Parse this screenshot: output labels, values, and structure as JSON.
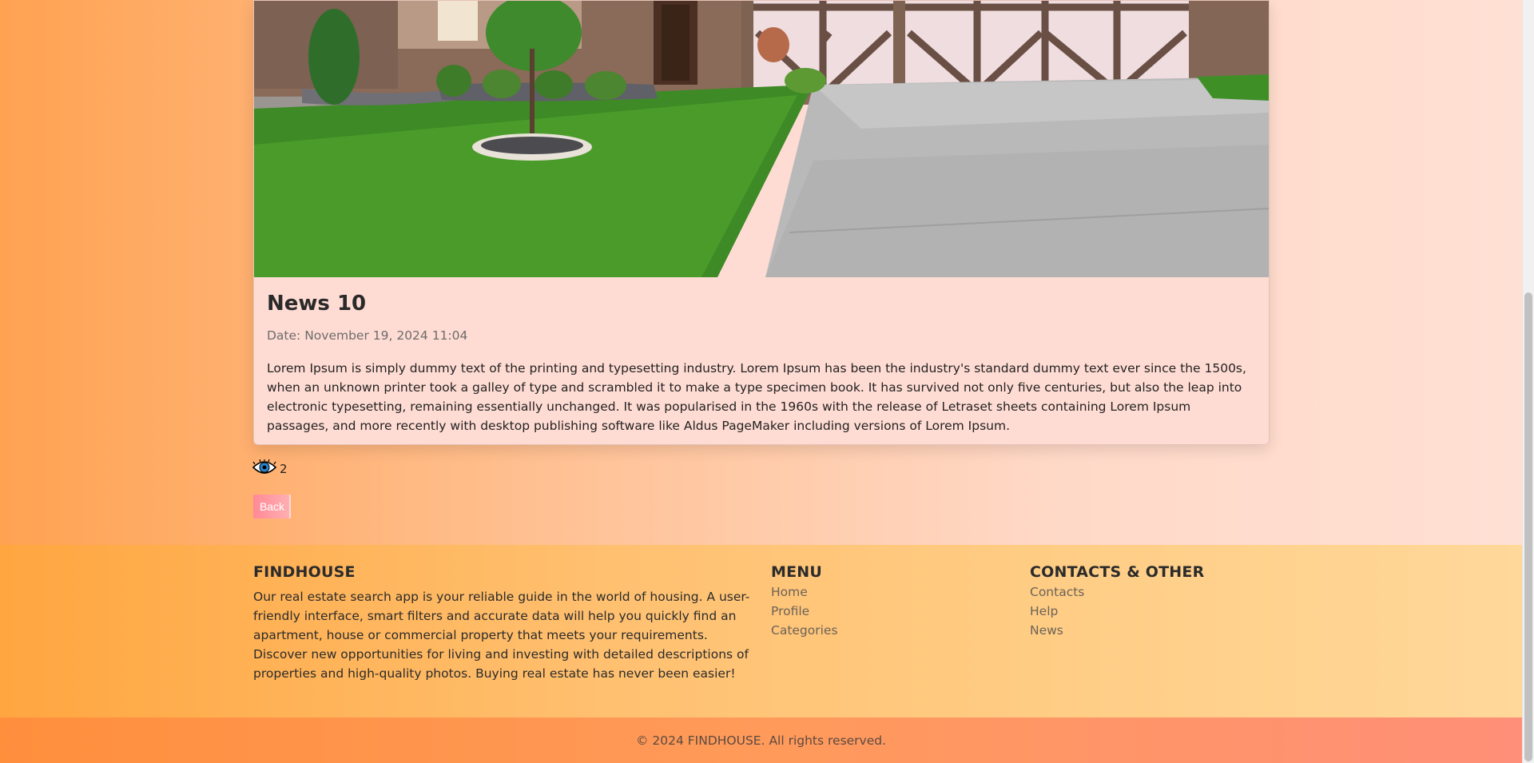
{
  "article": {
    "title": "News 10",
    "date": "Date: November 19, 2024 11:04",
    "body": "Lorem Ipsum is simply dummy text of the printing and typesetting industry. Lorem Ipsum has been the industry's standard dummy text ever since the 1500s, when an unknown printer took a galley of type and scrambled it to make a type specimen book. It has survived not only five centuries, but also the leap into electronic typesetting, remaining essentially unchanged. It was popularised in the 1960s with the release of Letraset sheets containing Lorem Ipsum passages, and more recently with desktop publishing software like Aldus PageMaker including versions of Lorem Ipsum.",
    "views": "2",
    "views_icon": "eye-icon",
    "back_label": "Back"
  },
  "footer": {
    "about": {
      "title": "FINDHOUSE",
      "text": "Our real estate search app is your reliable guide in the world of housing. A user-friendly interface, smart filters and accurate data will help you quickly find an apartment, house or commercial property that meets your requirements. Discover new opportunities for living and investing with detailed descriptions of properties and high-quality photos. Buying real estate has never been easier!"
    },
    "menu": {
      "title": "MENU",
      "items": [
        "Home",
        "Profile",
        "Categories"
      ]
    },
    "contacts": {
      "title": "CONTACTS & OTHER",
      "items": [
        "Contacts",
        "Help",
        "News"
      ]
    },
    "copyright": "© 2024 FINDHOUSE. All rights reserved."
  },
  "colors": {
    "card_bg": "#ffdcd3",
    "accent_button": "#ff8a96",
    "footer_top": "#ffc070",
    "footer_bottom": "#ff9a5a"
  }
}
